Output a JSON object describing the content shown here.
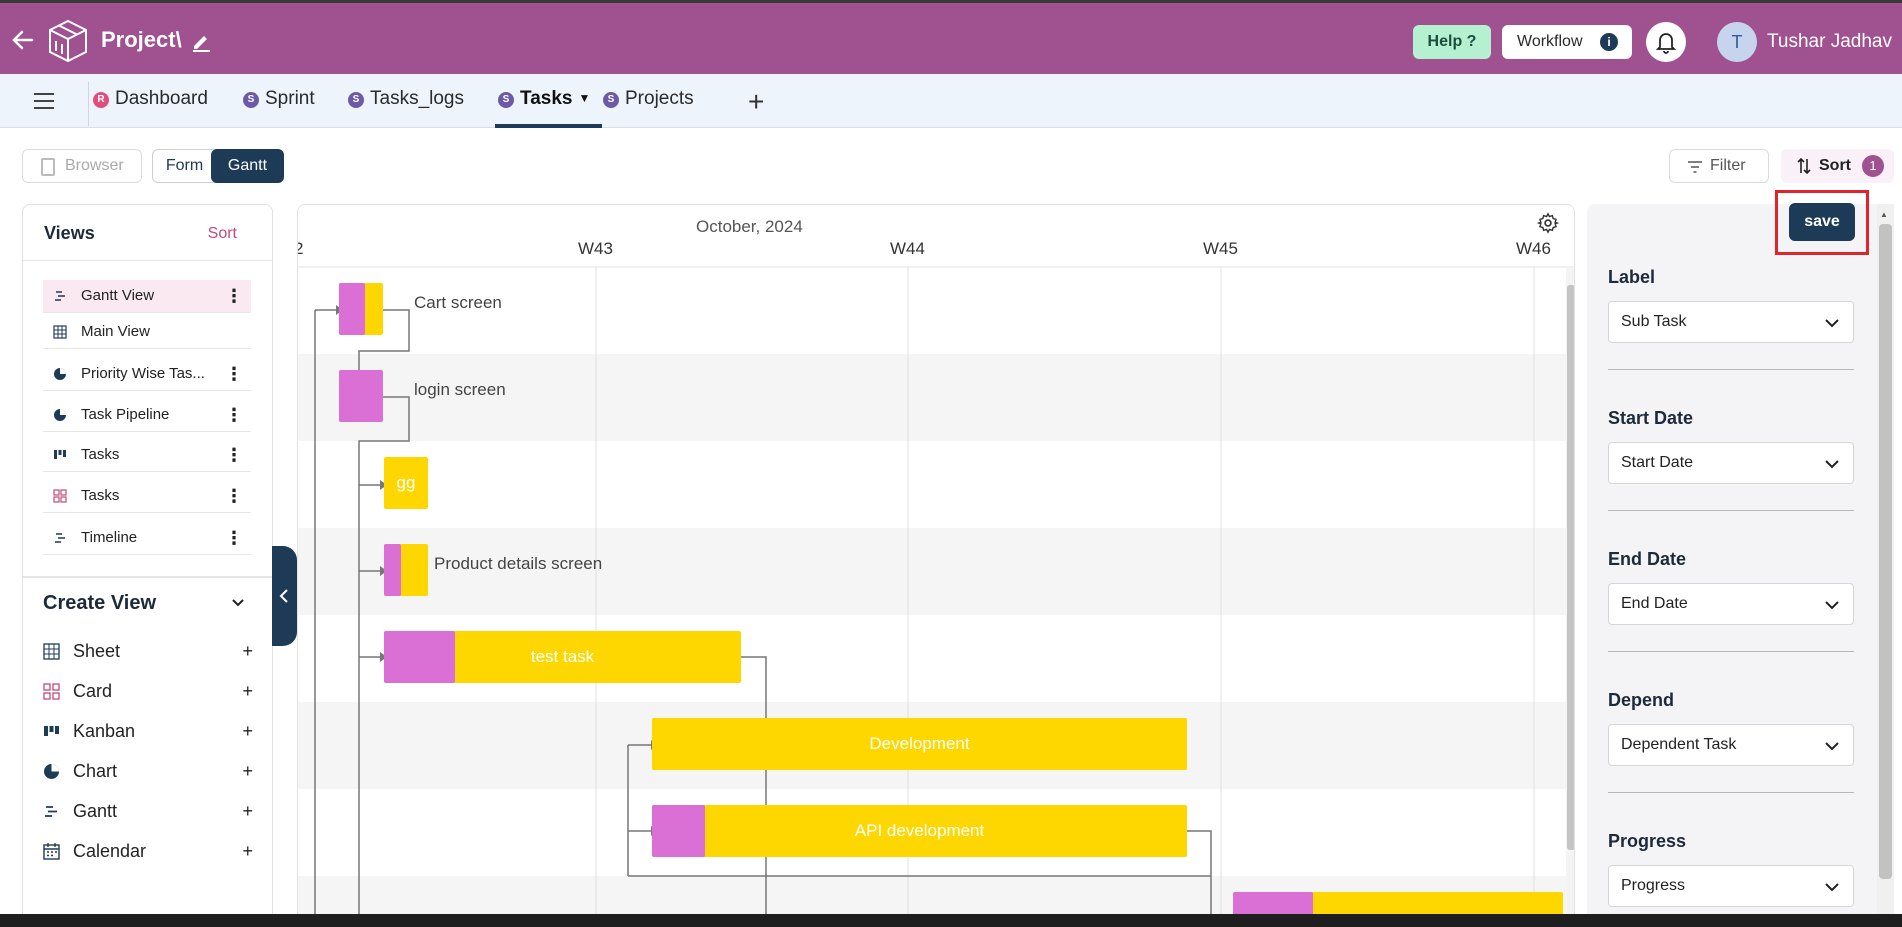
{
  "header": {
    "project_title": "Project\\",
    "help_label": "Help ?",
    "workflow_label": "Workflow",
    "user_initial": "T",
    "user_name": "Tushar Jadhav"
  },
  "tabs": [
    {
      "badge": "R",
      "label": "Dashboard"
    },
    {
      "badge": "S",
      "label": "Sprint"
    },
    {
      "badge": "S",
      "label": "Tasks_logs"
    },
    {
      "badge": "S",
      "label": "Tasks",
      "active": true
    },
    {
      "badge": "S",
      "label": "Projects"
    }
  ],
  "toolbar": {
    "browser_label": "Browser",
    "form_label": "Form",
    "gantt_label": "Gantt",
    "filter_label": "Filter",
    "sort_label": "Sort",
    "sort_count": "1"
  },
  "sidebar": {
    "views_title": "Views",
    "views_sort": "Sort",
    "views": [
      {
        "label": "Gantt View",
        "icon": "gantt-icon",
        "selected": true
      },
      {
        "label": "Main View",
        "icon": "grid-icon"
      },
      {
        "label": "Priority Wise Tas...",
        "icon": "pie-chart-icon"
      },
      {
        "label": "Task Pipeline",
        "icon": "pie-chart-icon"
      },
      {
        "label": "Tasks",
        "icon": "kanban-icon"
      },
      {
        "label": "Tasks",
        "icon": "card-icon"
      },
      {
        "label": "Timeline",
        "icon": "gantt-icon"
      }
    ],
    "create_title": "Create View",
    "create_items": [
      {
        "label": "Sheet",
        "icon": "grid-icon"
      },
      {
        "label": "Card",
        "icon": "card-icon"
      },
      {
        "label": "Kanban",
        "icon": "kanban-icon"
      },
      {
        "label": "Chart",
        "icon": "pie-chart-icon"
      },
      {
        "label": "Gantt",
        "icon": "gantt-icon"
      },
      {
        "label": "Calendar",
        "icon": "calendar-icon"
      }
    ]
  },
  "gantt": {
    "month_label": "October, 2024",
    "weeks": [
      "2",
      "W43",
      "W44",
      "W45",
      "W46"
    ],
    "tasks": [
      {
        "name": "Cart screen",
        "progress_color": "#da70d6",
        "bar_color": "#ffd700"
      },
      {
        "name": "login screen"
      },
      {
        "name": "gg"
      },
      {
        "name": "Product details screen"
      },
      {
        "name": "test task"
      },
      {
        "name": "Development"
      },
      {
        "name": "API development"
      }
    ]
  },
  "panel": {
    "save_label": "save",
    "fields": [
      {
        "label": "Label",
        "value": "Sub Task"
      },
      {
        "label": "Start Date",
        "value": "Start Date"
      },
      {
        "label": "End Date",
        "value": "End Date"
      },
      {
        "label": "Depend",
        "value": "Dependent Task"
      },
      {
        "label": "Progress",
        "value": "Progress"
      }
    ]
  },
  "colors": {
    "header_bg": "#a0518f",
    "accent_dark": "#1d3b57",
    "progress": "#da70d6",
    "bar": "#ffd700"
  }
}
